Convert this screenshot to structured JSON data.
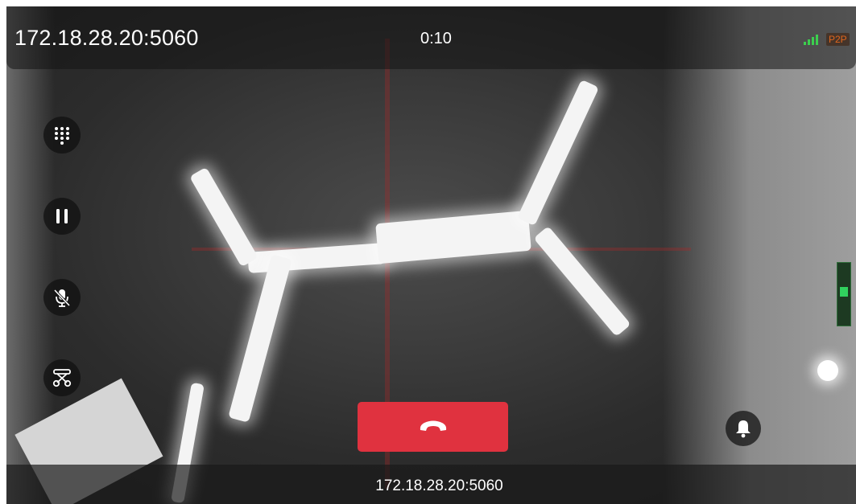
{
  "header": {
    "remote_address": "172.18.28.20:5060",
    "call_duration": "0:10",
    "signal_icon": "signal-bars-icon",
    "connection_badge": "P2P",
    "colors": {
      "signal": "#3ccf4e",
      "badge": "#e0661d"
    }
  },
  "controls": [
    {
      "name": "dialpad-button",
      "icon": "dialpad-icon"
    },
    {
      "name": "hold-button",
      "icon": "pause-icon"
    },
    {
      "name": "mute-button",
      "icon": "mic-off-icon"
    },
    {
      "name": "transfer-button",
      "icon": "transfer-icon"
    }
  ],
  "hangup": {
    "icon": "phone-hangup-icon",
    "color": "#e0323f"
  },
  "doorbell": {
    "icon": "bell-icon"
  },
  "footer": {
    "caller_address": "172.18.28.20:5060"
  }
}
